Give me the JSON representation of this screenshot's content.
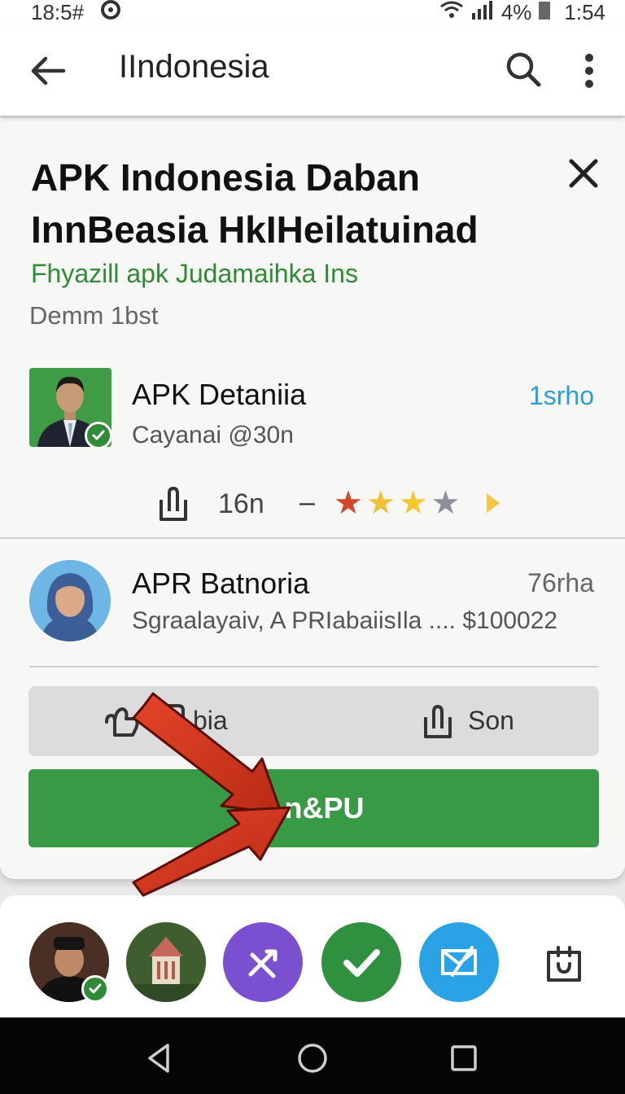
{
  "status_bar": {
    "time_left": "18:5#",
    "battery": "4%",
    "time_right": "1:54"
  },
  "app_bar": {
    "title": "IIndonesia"
  },
  "article": {
    "headline_line1": "APK Indonesia Daban",
    "headline_line2": "InnBeasia HkIHeilatuinad",
    "subhead": "Fhyazill apk Judamaihka Ins",
    "meta": "Demm 1bst"
  },
  "post1": {
    "title": "APK Detaniia",
    "subtitle": "Cayanai @30n",
    "time": "1srho",
    "share_count": "16n",
    "separator": "–",
    "rating_stars": 4
  },
  "post2": {
    "title": "APR Batnoria",
    "subtitle": "Sgraalayaiv,  A PRIabaiisIla .... $100022",
    "time": "76rha"
  },
  "actions": {
    "like_label": "bia",
    "share_label": "Son"
  },
  "cta": {
    "label": "An&PU"
  },
  "colors": {
    "accent_green": "#399a45",
    "link_blue": "#2a9fd6",
    "arrow_red": "#d9351b"
  }
}
